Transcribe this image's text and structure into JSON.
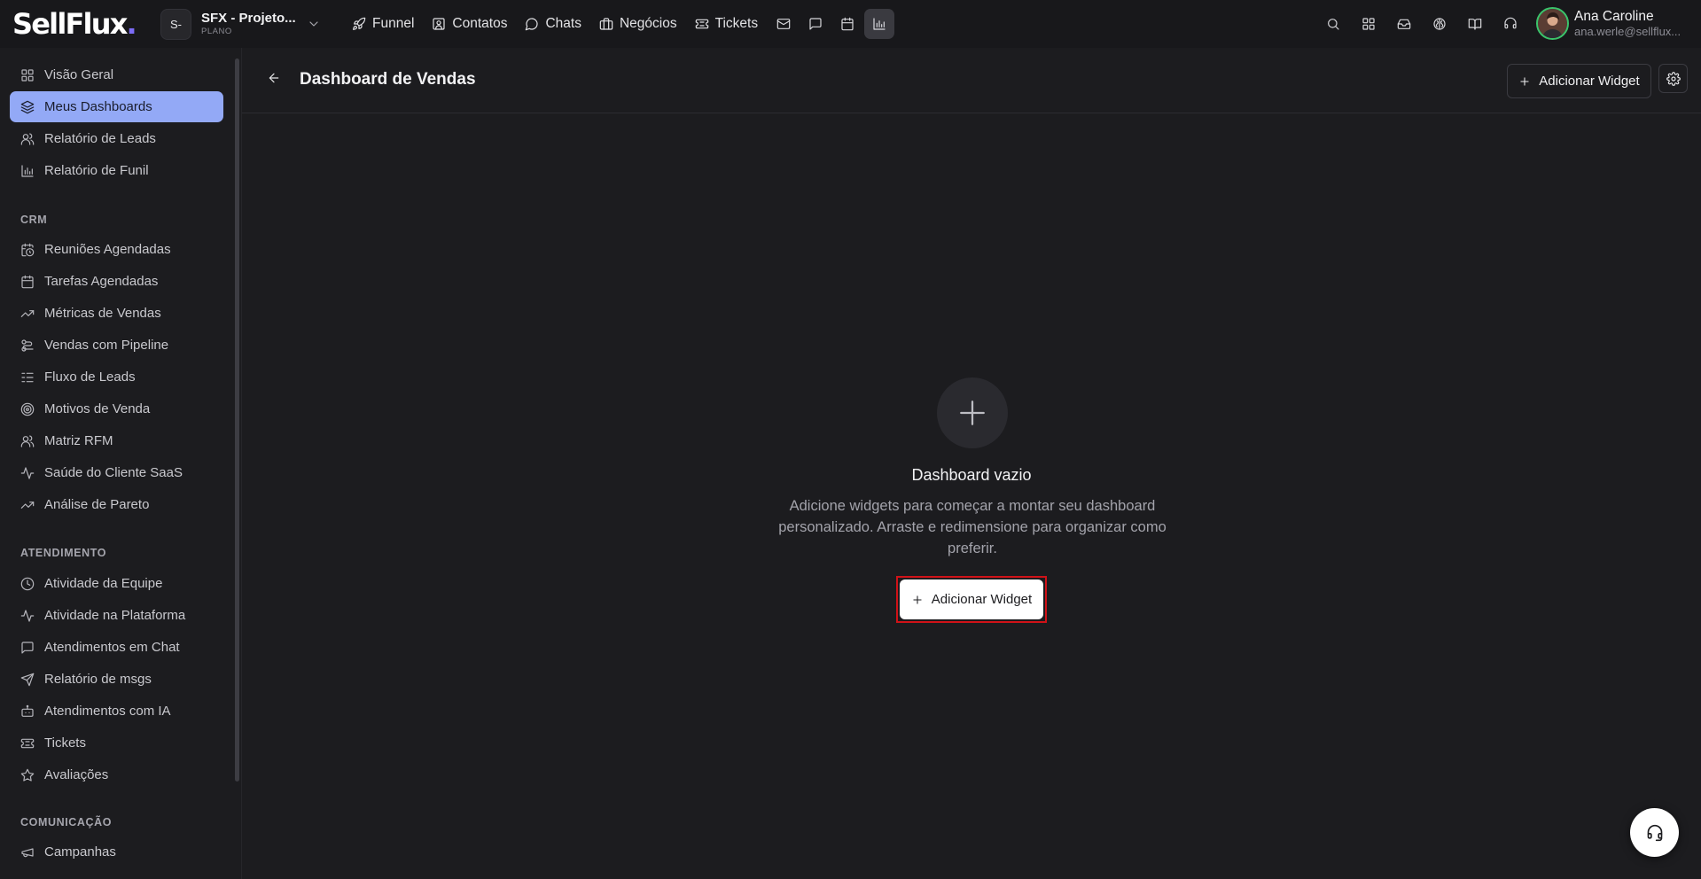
{
  "brand": {
    "logo_text": "SellFlux",
    "logo_dot": "."
  },
  "project": {
    "avatar": "S-",
    "name": "SFX - Projeto...",
    "plan": "PLANO"
  },
  "topnav": {
    "items": [
      {
        "label": "Funnel",
        "icon": "rocket-icon"
      },
      {
        "label": "Contatos",
        "icon": "contact-icon"
      },
      {
        "label": "Chats",
        "icon": "chat-icon"
      },
      {
        "label": "Negócios",
        "icon": "briefcase-icon"
      },
      {
        "label": "Tickets",
        "icon": "ticket-icon"
      }
    ],
    "icon_buttons": [
      "mail-icon",
      "message-square-icon",
      "calendar-icon",
      "bar-chart-icon"
    ],
    "active_icon": "bar-chart-icon"
  },
  "user": {
    "name": "Ana Caroline",
    "email": "ana.werle@sellflux..."
  },
  "sidebar": {
    "items_top": [
      {
        "label": "Visão Geral",
        "icon": "grid-icon"
      },
      {
        "label": "Meus Dashboards",
        "icon": "layers-icon",
        "active": true
      },
      {
        "label": "Relatório de Leads",
        "icon": "users-icon"
      },
      {
        "label": "Relatório de Funil",
        "icon": "bar-chart-icon"
      }
    ],
    "crm_title": "CRM",
    "crm": [
      {
        "label": "Reuniões Agendadas",
        "icon": "calendar-clock-icon"
      },
      {
        "label": "Tarefas Agendadas",
        "icon": "calendar-icon"
      },
      {
        "label": "Métricas de Vendas",
        "icon": "trending-up-icon"
      },
      {
        "label": "Vendas com Pipeline",
        "icon": "pipeline-icon"
      },
      {
        "label": "Fluxo de Leads",
        "icon": "list-flow-icon"
      },
      {
        "label": "Motivos de Venda",
        "icon": "target-icon"
      },
      {
        "label": "Matriz RFM",
        "icon": "users-icon"
      },
      {
        "label": "Saúde do Cliente SaaS",
        "icon": "activity-icon"
      },
      {
        "label": "Análise de Pareto",
        "icon": "trending-up-icon"
      }
    ],
    "atendimento_title": "ATENDIMENTO",
    "atendimento": [
      {
        "label": "Atividade da Equipe",
        "icon": "clock-icon"
      },
      {
        "label": "Atividade na Plataforma",
        "icon": "activity-icon"
      },
      {
        "label": "Atendimentos em Chat",
        "icon": "message-square-icon"
      },
      {
        "label": "Relatório de msgs",
        "icon": "send-icon"
      },
      {
        "label": "Atendimentos com IA",
        "icon": "bot-icon"
      },
      {
        "label": "Tickets",
        "icon": "ticket-icon"
      },
      {
        "label": "Avaliações",
        "icon": "star-icon"
      }
    ],
    "comunicacao_title": "COMUNICAÇÃO",
    "comunicacao": [
      {
        "label": "Campanhas",
        "icon": "megaphone-icon"
      }
    ]
  },
  "main": {
    "title": "Dashboard de Vendas",
    "header_add_label": "Adicionar Widget",
    "empty_title": "Dashboard vazio",
    "empty_description": "Adicione widgets para começar a montar seu dashboard personalizado. Arraste e redimensione para organizar como preferir.",
    "cta_label": "Adicionar Widget"
  },
  "colors": {
    "background": "#1c1c1f",
    "topbar": "#18181b",
    "active_sidebar": "#93a9f6",
    "highlight_outline": "#d01218",
    "brand_dot": "#7c6cf6",
    "avatar_ring": "#3bc46b"
  }
}
